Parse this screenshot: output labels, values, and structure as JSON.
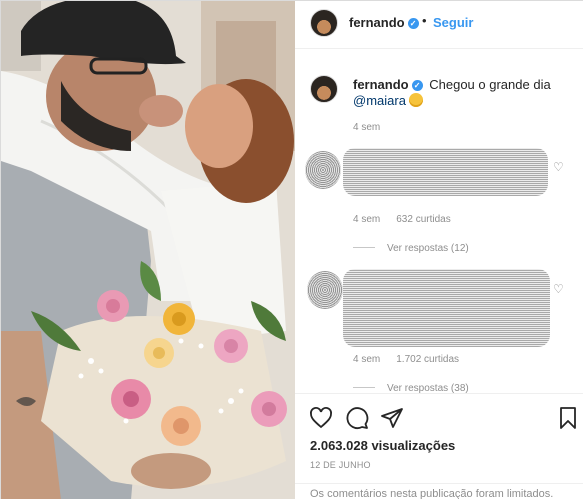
{
  "header": {
    "username": "fernando",
    "separator": "•",
    "follow_label": "Seguir"
  },
  "caption": {
    "username": "fernando",
    "text": "Chegou o grande dia",
    "mention": "@maiara",
    "time": "4 sem"
  },
  "comments": [
    {
      "time": "4 sem",
      "likes": "632 curtidas",
      "replies": "Ver respostas (12)"
    },
    {
      "time": "4 sem",
      "likes": "1.702 curtidas",
      "replies": "Ver respostas (38)"
    }
  ],
  "footer": {
    "views": "2.063.028 visualizações",
    "date": "12 DE JUNHO",
    "limited_notice": "Os comentários nesta publicação foram limitados."
  },
  "icons": {
    "verified": "verified-badge-icon",
    "like": "heart-icon",
    "comment": "comment-icon",
    "share": "paper-plane-icon",
    "save": "bookmark-icon"
  },
  "colors": {
    "link": "#3897f0",
    "mention": "#00376b",
    "muted": "#8e8e8e",
    "text": "#262626"
  }
}
